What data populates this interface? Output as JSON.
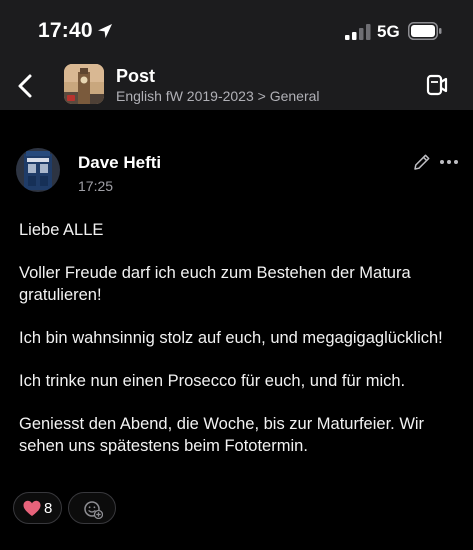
{
  "status_bar": {
    "time": "17:40",
    "network": "5G",
    "icons": [
      "location-arrow-icon",
      "signal-bars-icon",
      "battery-icon"
    ]
  },
  "nav": {
    "title": "Post",
    "subtitle": "English fW 2019-2023 > General",
    "icons": [
      "chevron-left-icon",
      "channel-avatar",
      "video-call-icon"
    ]
  },
  "post": {
    "author": "Dave Hefti",
    "time": "17:25",
    "paragraphs": [
      "Liebe ALLE",
      "Voller Freude darf ich euch zum Bestehen der Matura gratulieren!",
      "Ich bin wahnsinnig stolz auf euch, und megagigaglücklich!",
      "Ich trinke nun einen Prosecco für euch, und für mich.",
      "Geniesst den Abend, die Woche, bis zur Maturfeier. Wir sehen uns spätestens beim Fototermin."
    ],
    "actions": [
      "pencil-icon",
      "more-icon"
    ]
  },
  "reactions": {
    "heart_count": "8",
    "colors": {
      "heart": "#e8637b",
      "chip_border": "#38383c"
    }
  }
}
